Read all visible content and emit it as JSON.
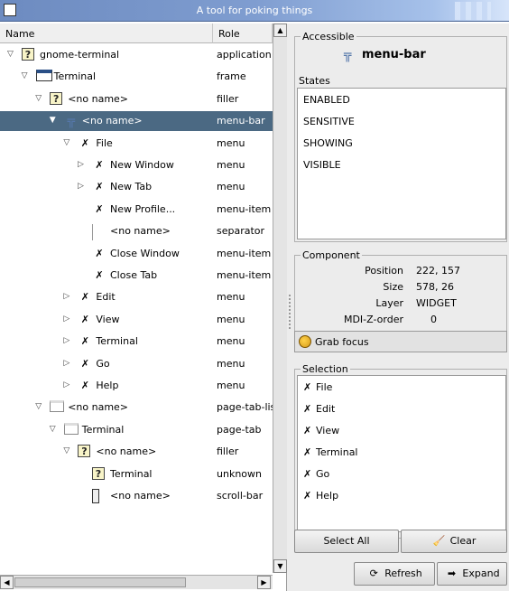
{
  "window": {
    "title": "A tool for poking things"
  },
  "tree": {
    "columns": {
      "name": "Name",
      "role": "Role"
    },
    "rows": [
      {
        "name": "gnome-terminal",
        "role": "application",
        "exp": "▽",
        "icon": "?"
      },
      {
        "name": "Terminal",
        "role": "frame",
        "exp": "▽",
        "icon": ""
      },
      {
        "name": "<no name>",
        "role": "filler",
        "exp": "▽",
        "icon": "?"
      },
      {
        "name": "<no name>",
        "role": "menu-bar",
        "exp": "▼",
        "icon": "╦"
      },
      {
        "name": "File",
        "role": "menu",
        "exp": "▽",
        "icon": "✗"
      },
      {
        "name": "New Window",
        "role": "menu",
        "exp": "▷",
        "icon": "✗"
      },
      {
        "name": "New Tab",
        "role": "menu",
        "exp": "▷",
        "icon": "✗"
      },
      {
        "name": "New Profile...",
        "role": "menu-item",
        "exp": "",
        "icon": "✗"
      },
      {
        "name": "<no name>",
        "role": "separator",
        "exp": "",
        "icon": ""
      },
      {
        "name": "Close Window",
        "role": "menu-item",
        "exp": "",
        "icon": "✗"
      },
      {
        "name": "Close Tab",
        "role": "menu-item",
        "exp": "",
        "icon": "✗"
      },
      {
        "name": "Edit",
        "role": "menu",
        "exp": "▷",
        "icon": "✗"
      },
      {
        "name": "View",
        "role": "menu",
        "exp": "▷",
        "icon": "✗"
      },
      {
        "name": "Terminal",
        "role": "menu",
        "exp": "▷",
        "icon": "✗"
      },
      {
        "name": "Go",
        "role": "menu",
        "exp": "▷",
        "icon": "✗"
      },
      {
        "name": "Help",
        "role": "menu",
        "exp": "▷",
        "icon": "✗"
      },
      {
        "name": "<no name>",
        "role": "page-tab-list",
        "exp": "▽",
        "icon": ""
      },
      {
        "name": "Terminal",
        "role": "page-tab",
        "exp": "▽",
        "icon": ""
      },
      {
        "name": "<no name>",
        "role": "filler",
        "exp": "▽",
        "icon": "?"
      },
      {
        "name": "Terminal",
        "role": "unknown",
        "exp": "",
        "icon": "?"
      },
      {
        "name": "<no name>",
        "role": "scroll-bar",
        "exp": "",
        "icon": ""
      }
    ]
  },
  "accessible": {
    "legend": "Accessible",
    "name": "menu-bar",
    "states_label": "States",
    "states": [
      "ENABLED",
      "SENSITIVE",
      "SHOWING",
      "VISIBLE"
    ]
  },
  "component": {
    "legend": "Component",
    "position_label": "Position",
    "position": "222, 157",
    "size_label": "Size",
    "size": "578, 26",
    "layer_label": "Layer",
    "layer": "WIDGET",
    "mdiz_label": "MDI-Z-order",
    "mdiz": "0",
    "grab_label": "Grab focus"
  },
  "selection": {
    "legend": "Selection",
    "items": [
      "File",
      "Edit",
      "View",
      "Terminal",
      "Go",
      "Help"
    ],
    "select_all": "Select All",
    "clear": "Clear"
  },
  "buttons": {
    "refresh": "Refresh",
    "expand": "Expand"
  }
}
